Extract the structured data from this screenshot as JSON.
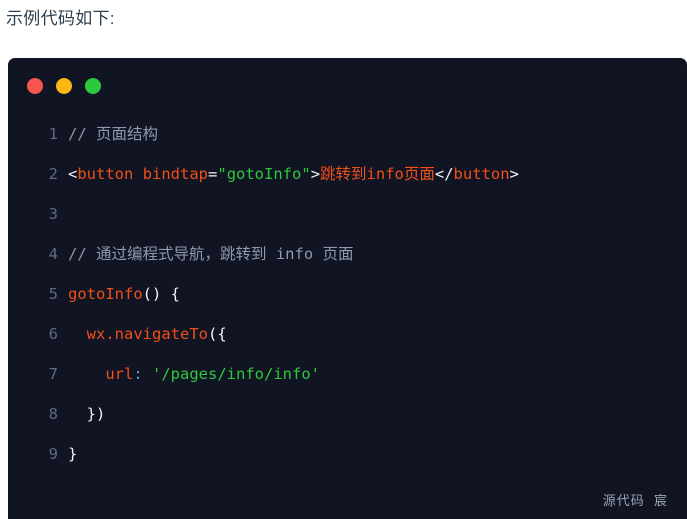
{
  "page": {
    "background": "#ffffff",
    "heading": "示例代码如下:",
    "heading_color": "#2d3e50"
  },
  "code_card": {
    "background": "#101423",
    "titlebar": {
      "dots": [
        {
          "name": "close",
          "color": "#f8554f"
        },
        {
          "name": "minimize",
          "color": "#f9b615"
        },
        {
          "name": "maximize",
          "color": "#2dc93c"
        }
      ]
    },
    "language_hint": "wxml-js",
    "line_numbers": [
      "1",
      "2",
      "3",
      "4",
      "5",
      "6",
      "7",
      "8",
      "9"
    ],
    "lines": [
      {
        "number": "1",
        "plain": "// 页面结构",
        "tokens": [
          {
            "t": "comment",
            "v": "// 页面结构"
          }
        ]
      },
      {
        "number": "2",
        "plain": "<button bindtap=\"gotoInfo\">跳转到info页面</button>",
        "tokens": [
          {
            "t": "punct",
            "v": "<"
          },
          {
            "t": "tag",
            "v": "button"
          },
          {
            "t": "plain",
            "v": " "
          },
          {
            "t": "attr",
            "v": "bindtap"
          },
          {
            "t": "op",
            "v": "="
          },
          {
            "t": "string",
            "v": "\"gotoInfo\""
          },
          {
            "t": "punct",
            "v": ">"
          },
          {
            "t": "text",
            "v": "跳转到info页面"
          },
          {
            "t": "punct",
            "v": "</"
          },
          {
            "t": "tag",
            "v": "button"
          },
          {
            "t": "punct",
            "v": ">"
          }
        ]
      },
      {
        "number": "3",
        "plain": "",
        "tokens": []
      },
      {
        "number": "4",
        "plain": "// 通过编程式导航，跳转到 info 页面",
        "tokens": [
          {
            "t": "comment",
            "v": "// 通过编程式导航，跳转到 info 页面"
          }
        ]
      },
      {
        "number": "5",
        "plain": "gotoInfo() {",
        "tokens": [
          {
            "t": "fn",
            "v": "gotoInfo"
          },
          {
            "t": "punct",
            "v": "() {"
          }
        ]
      },
      {
        "number": "6",
        "plain": "  wx.navigateTo({",
        "tokens": [
          {
            "t": "plain",
            "v": "  "
          },
          {
            "t": "prop",
            "v": "wx.navigateTo"
          },
          {
            "t": "punct",
            "v": "({"
          }
        ]
      },
      {
        "number": "7",
        "plain": "    url: '/pages/info/info'",
        "tokens": [
          {
            "t": "plain",
            "v": "    "
          },
          {
            "t": "prop",
            "v": "url"
          },
          {
            "t": "colon",
            "v": ":"
          },
          {
            "t": "plain",
            "v": " "
          },
          {
            "t": "string",
            "v": "'/pages/info/info'"
          }
        ]
      },
      {
        "number": "8",
        "plain": "  })",
        "tokens": [
          {
            "t": "plain",
            "v": "  "
          },
          {
            "t": "punct",
            "v": "})"
          }
        ]
      },
      {
        "number": "9",
        "plain": "}",
        "tokens": [
          {
            "t": "punct",
            "v": "}"
          }
        ]
      }
    ],
    "watermark": "源代码  宸"
  }
}
